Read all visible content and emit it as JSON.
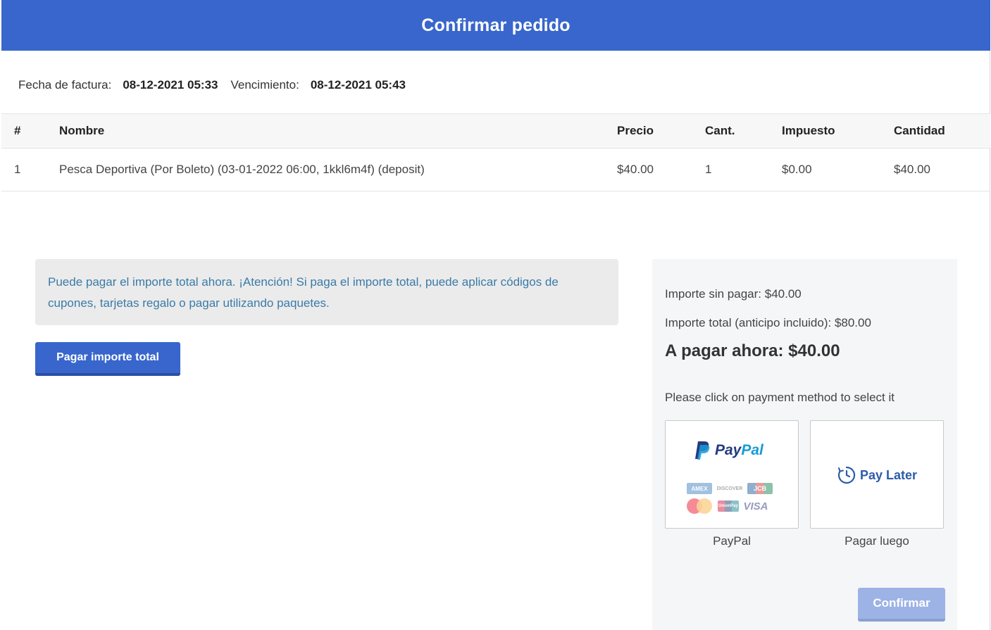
{
  "header": {
    "title": "Confirmar pedido"
  },
  "invoice": {
    "date_label": "Fecha de factura:",
    "date_value": "08-12-2021 05:33",
    "due_label": "Vencimiento:",
    "due_value": "08-12-2021 05:43"
  },
  "table": {
    "columns": [
      "#",
      "Nombre",
      "Precio",
      "Cant.",
      "Impuesto",
      "Cantidad"
    ],
    "rows": [
      [
        "1",
        "Pesca Deportiva (Por Boleto) (03-01-2022 06:00, 1kkl6m4f) (deposit)",
        "$40.00",
        "1",
        "$0.00",
        "$40.00"
      ]
    ]
  },
  "notice": {
    "text": "Puede pagar el importe total ahora. ¡Atención! Si paga el importe total, puede aplicar códigos de cupones, tarjetas regalo o pagar utilizando paquetes."
  },
  "pay_full_button": "Pagar importe total",
  "summary": {
    "unpaid": "Importe sin pagar: $40.00",
    "total": "Importe total (anticipo incluido): $80.00",
    "pay_now": "A pagar ahora: $40.00",
    "hint": "Please click on payment method to select it"
  },
  "methods": {
    "paypal": {
      "logo_pay": "Pay",
      "logo_pal": "Pal",
      "caption": "PayPal",
      "cards": {
        "amex": "AMEX",
        "discover": "DISCOVER",
        "jcb": "JCB",
        "unionpay": "UnionPay",
        "visa": "VISA"
      },
      "icon": "paypal-logo-icon"
    },
    "later": {
      "logo_text": "Pay Later",
      "caption": "Pagar luego",
      "icon": "clock-icon"
    }
  },
  "confirm_button": "Confirmar",
  "colors": {
    "primary": "#3866cc",
    "primary_disabled": "#9db3e6",
    "notice_text": "#3a7ba8",
    "paypal_dark": "#253b80",
    "paypal_light": "#179bd7"
  }
}
